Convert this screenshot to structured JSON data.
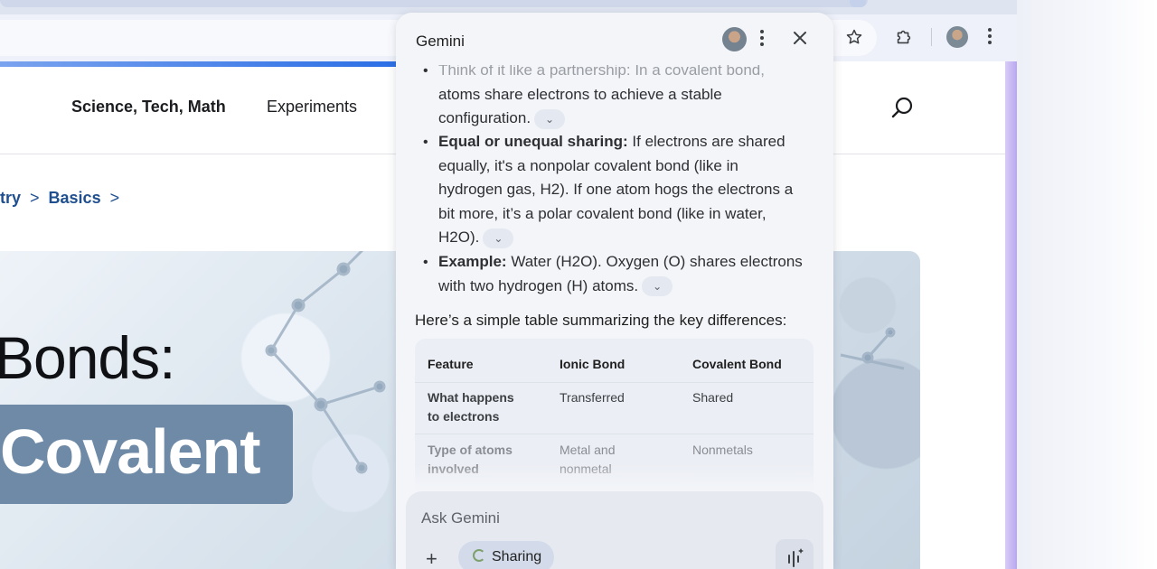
{
  "browser": {
    "toolbar_icons": [
      "star-icon",
      "extensions-icon",
      "profile-avatar",
      "more-vert-icon"
    ]
  },
  "site": {
    "nav": {
      "science": "Science, Tech, Math",
      "experiments": "Experiments"
    },
    "breadcrumb": {
      "item1": "try",
      "item2": "Basics",
      "sep": ">"
    },
    "hero": {
      "line1": "Bonds:",
      "line2": "Covalent"
    }
  },
  "gemini": {
    "title": "Gemini",
    "bullet1_lines": [
      "Think of it like a partnership: In a covalent bond,",
      "atoms share electrons to achieve a stable",
      "configuration."
    ],
    "bullet2": {
      "label": "Equal or unequal sharing:",
      "lines": [
        " If electrons are shared",
        "equally, it's a nonpolar covalent bond (like in",
        "hydrogen gas, H2). If one atom hogs the electrons a",
        "bit more, it’s a polar covalent bond (like in water,",
        "H2O)."
      ]
    },
    "bullet3": {
      "label": "Example:",
      "lines": [
        " Water (H2O). Oxygen (O) shares electrons",
        "with two hydrogen (H) atoms."
      ]
    },
    "chevron": "⌄",
    "summary": "Here’s a simple table summarizing the key differences:",
    "table": {
      "headers": [
        "Feature",
        "Ionic Bond",
        "Covalent Bond"
      ],
      "rows": [
        {
          "feature": [
            "What happens",
            "to electrons"
          ],
          "ionic": [
            "Transferred"
          ],
          "covalent": [
            "Shared"
          ]
        },
        {
          "feature": [
            "Type of atoms",
            "involved"
          ],
          "ionic": [
            "Metal and",
            "nonmetal"
          ],
          "covalent": [
            "Nonmetals"
          ]
        }
      ]
    },
    "input": {
      "placeholder": "Ask Gemini",
      "plus": "+",
      "chip_label": "Sharing"
    }
  }
}
